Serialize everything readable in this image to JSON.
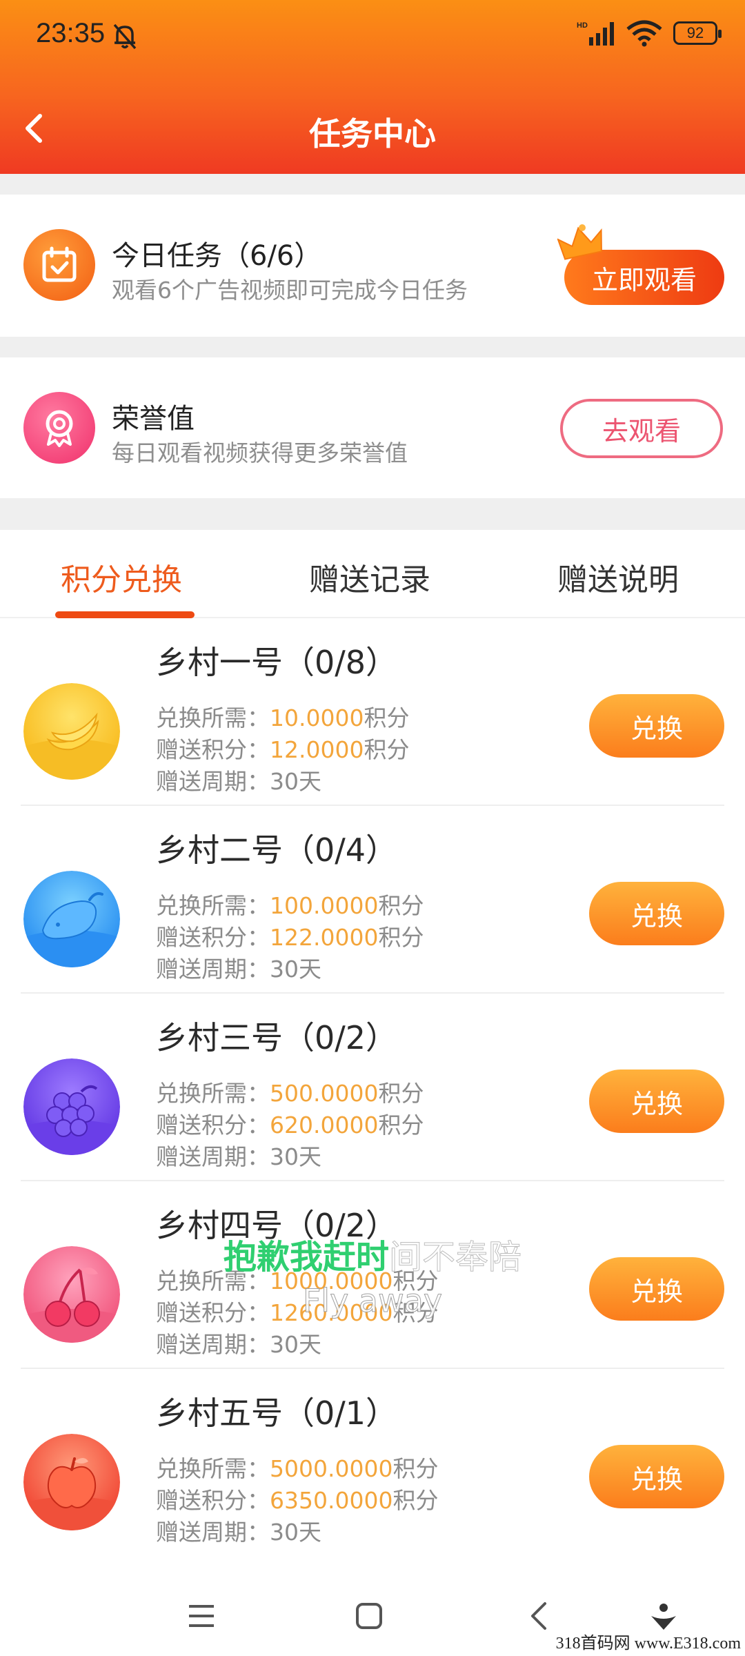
{
  "status_bar": {
    "time": "23:35",
    "battery": "92",
    "network": "HD"
  },
  "header": {
    "title": "任务中心"
  },
  "daily_task": {
    "title": "今日任务（6/6）",
    "desc": "观看6个广告视频即可完成今日任务",
    "button": "立即观看"
  },
  "honor": {
    "title": "荣誉值",
    "desc": "每日观看视频获得更多荣誉值",
    "button": "去观看"
  },
  "tabs": [
    {
      "label": "积分兑换",
      "active": true
    },
    {
      "label": "赠送记录",
      "active": false
    },
    {
      "label": "赠送说明",
      "active": false
    }
  ],
  "labels": {
    "cost": "兑换所需：",
    "gift": "赠送积分：",
    "cycle": "赠送周期：",
    "unit": "积分",
    "redeem": "兑换"
  },
  "items": [
    {
      "name": "乡村一号（0/8）",
      "cost": "10.0000",
      "gift": "12.0000",
      "cycle": "30天",
      "icon": "banana-icon",
      "color": "#f7c21f"
    },
    {
      "name": "乡村二号（0/4）",
      "cost": "100.0000",
      "gift": "122.0000",
      "cycle": "30天",
      "icon": "mango-icon",
      "color": "#2d9bf0"
    },
    {
      "name": "乡村三号（0/2）",
      "cost": "500.0000",
      "gift": "620.0000",
      "cycle": "30天",
      "icon": "grape-icon",
      "color": "#6b44e6"
    },
    {
      "name": "乡村四号（0/2）",
      "cost": "1000.0000",
      "gift": "1260.0000",
      "cycle": "30天",
      "icon": "cherry-icon",
      "color": "#f0557a"
    },
    {
      "name": "乡村五号（0/1）",
      "cost": "5000.0000",
      "gift": "6350.0000",
      "cycle": "30天",
      "icon": "apple-icon",
      "color": "#f04a34"
    }
  ],
  "subtitle": {
    "cn_highlight": "抱歉我赶时",
    "cn_rest": "间不奉陪",
    "en": "Fly away"
  },
  "watermark": "318首码网 www.E318.com"
}
